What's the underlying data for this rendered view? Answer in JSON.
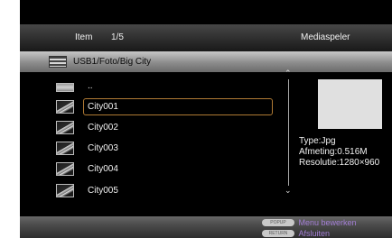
{
  "header": {
    "item_label": "Item",
    "count": "1/5",
    "title": "Mediaspeler"
  },
  "path": {
    "icon": "usb-drive-icon",
    "text": "USB1/Foto/Big City"
  },
  "list": {
    "up_item": {
      "label": "..",
      "icon": "folder-up-icon"
    },
    "items": [
      {
        "label": "City001",
        "selected": true,
        "icon": "image-thumbnail-icon"
      },
      {
        "label": "City002",
        "selected": false,
        "icon": "image-thumbnail-icon"
      },
      {
        "label": "City003",
        "selected": false,
        "icon": "image-thumbnail-icon"
      },
      {
        "label": "City004",
        "selected": false,
        "icon": "image-thumbnail-icon"
      },
      {
        "label": "City005",
        "selected": false,
        "icon": "image-thumbnail-icon"
      }
    ]
  },
  "scrollbar": {
    "up_glyph": "⌃",
    "down_glyph": "⌄"
  },
  "info": {
    "type": "Type:Jpg",
    "size": "Afmeting:0.516M",
    "resolution": "Resolutie:1280×960"
  },
  "footer": {
    "popup_key": "POPUP",
    "popup_label": "Menu bewerken",
    "return_key": "RETURN",
    "return_label": "Afsluiten"
  },
  "colors": {
    "selection_border": "#b07a34",
    "footer_text": "#a47fd6",
    "preview_background": "#e0e0e0"
  }
}
